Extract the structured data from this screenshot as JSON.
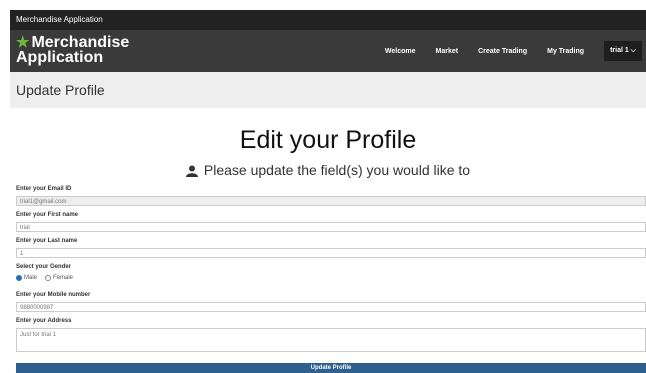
{
  "window": {
    "title": "Merchandise Application"
  },
  "navbar": {
    "brand_line1": "Merchandise",
    "brand_line2": "Application",
    "links": [
      "Welcome",
      "Market",
      "Create Trading",
      "My Trading"
    ],
    "user": "trial 1 ⌵"
  },
  "page_header": {
    "title": "Update Profile"
  },
  "form": {
    "title": "Edit your Profile",
    "subtitle": "Please update the field(s) you would like to",
    "email_label": "Enter your Email ID",
    "email_value": "trial1@gmail.com",
    "first_name_label": "Enter your First name",
    "first_name_value": "trial",
    "last_name_label": "Enter your Last name",
    "last_name_value": "1",
    "gender_label": "Select your Gender",
    "gender_options": [
      "Male",
      "Female"
    ],
    "gender_selected": "Male",
    "mobile_label": "Enter your Mobile number",
    "mobile_value": "9880000987",
    "address_label": "Enter your Address",
    "address_value": "Just for trial 1",
    "submit_label": "Update Profile"
  },
  "colors": {
    "brand_star": "#6fb53a",
    "submit_bg": "#2d5f8f",
    "navbar_bg": "#3a3a3a"
  }
}
